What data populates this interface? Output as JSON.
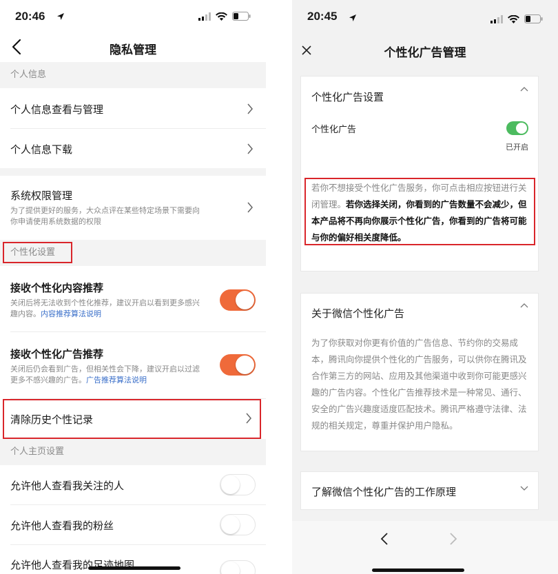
{
  "left": {
    "status": {
      "time": "20:46"
    },
    "nav": {
      "title": "隐私管理"
    },
    "sections": {
      "personal_info": "个人信息",
      "personalization": "个性化设置",
      "homepage": "个人主页设置"
    },
    "items": {
      "info_view": "个人信息查看与管理",
      "info_download": "个人信息下载",
      "perm_title": "系统权限管理",
      "perm_desc": "为了提供更好的服务，大众点评在某些特定场景下需要向你申请使用系统数据的权限",
      "content_rec_title": "接收个性化内容推荐",
      "content_rec_desc": "关闭后将无法收到个性化推荐，建议开启以看到更多感兴趣内容。",
      "content_rec_link": "内容推荐算法说明",
      "ad_rec_title": "接收个性化广告推荐",
      "ad_rec_desc": "关闭后仍会看到广告，但相关性会下降，建议开启以过滤更多不感兴趣的广告。",
      "ad_rec_link": "广告推荐算法说明",
      "clear_history": "清除历史个性记录",
      "allow_following": "允许他人查看我关注的人",
      "allow_fans": "允许他人查看我的粉丝",
      "allow_footprint": "允许他人查看我的足迹地图"
    },
    "toggles": {
      "content_rec": true,
      "ad_rec": true,
      "following": false,
      "fans": false,
      "footprint": false
    }
  },
  "right": {
    "status": {
      "time": "20:45"
    },
    "nav": {
      "title": "个性化广告管理"
    },
    "card1": {
      "title": "个性化广告设置",
      "setting_label": "个性化广告",
      "toggle_state": "已开启",
      "notice_normal": "若你不想接受个性化广告服务，你可点击相应按钮进行关闭管理。",
      "notice_bold": "若你选择关闭，你看到的广告数量不会减少，但本产品将不再向你展示个性化广告，你看到的广告将可能与你的偏好相关度降低。"
    },
    "card2": {
      "title": "关于微信个性化广告",
      "body": "为了你获取对你更有价值的广告信息、节约你的交易成本，腾讯向你提供个性化的广告服务，可以供你在腾讯及合作第三方的网站、应用及其他渠道中收到你可能更感兴趣的广告内容。个性化广告推荐技术是一种常见、通行、安全的广告兴趣度适度匹配技术。腾讯严格遵守法律、法规的相关规定，尊重并保护用户隐私。"
    },
    "card3": {
      "title": "了解微信个性化广告的工作原理"
    }
  },
  "colors": {
    "accent_orange": "#ef6a3a",
    "toggle_green": "#4cbb5f",
    "highlight_red": "#d9252a",
    "link_blue": "#3a6fc9"
  },
  "icons": [
    "back-chevron-icon",
    "close-icon",
    "chevron-right-icon",
    "caret-up-icon",
    "caret-down-icon",
    "signal-icon",
    "wifi-icon",
    "battery-icon",
    "location-arrow-icon"
  ]
}
